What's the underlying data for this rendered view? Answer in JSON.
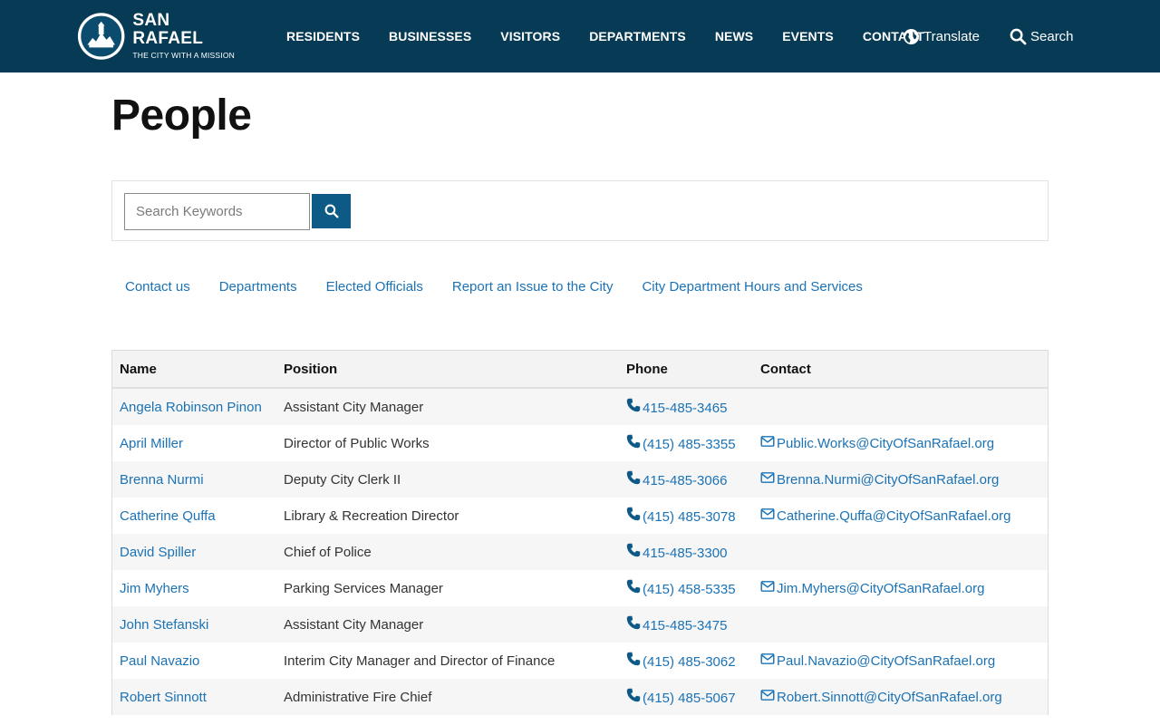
{
  "header": {
    "logo_name": "SAN RAFAEL",
    "logo_tagline": "THE CITY WITH A MISSION",
    "nav": [
      "RESIDENTS",
      "BUSINESSES",
      "VISITORS",
      "DEPARTMENTS",
      "NEWS",
      "EVENTS",
      "CONTACT"
    ],
    "translate_label": "Translate",
    "search_label": "Search",
    "colors": {
      "bar": "#073b55",
      "text": "#ffffff"
    }
  },
  "page": {
    "title": "People"
  },
  "search": {
    "placeholder": "Search Keywords",
    "value": "",
    "button_icon": "search-icon"
  },
  "quick_links": [
    "Contact us",
    "Departments",
    "Elected Officials",
    "Report an Issue to the City",
    "City Department Hours and Services"
  ],
  "table": {
    "columns": [
      "Name",
      "Position",
      "Phone",
      "Contact"
    ],
    "rows": [
      {
        "name": "Angela Robinson Pinon",
        "position": "Assistant City Manager",
        "phone": "415-485-3465",
        "email": ""
      },
      {
        "name": "April Miller",
        "position": "Director of Public Works",
        "phone": "(415) 485-3355",
        "email": "Public.Works@CityOfSanRafael.org"
      },
      {
        "name": "Brenna Nurmi",
        "position": "Deputy City Clerk II",
        "phone": "415-485-3066",
        "email": "Brenna.Nurmi@CityOfSanRafael.org"
      },
      {
        "name": "Catherine Quffa",
        "position": "Library & Recreation Director",
        "phone": "(415) 485-3078",
        "email": "Catherine.Quffa@CityOfSanRafael.org"
      },
      {
        "name": "David Spiller",
        "position": "Chief of Police",
        "phone": "415-485-3300",
        "email": ""
      },
      {
        "name": "Jim Myhers",
        "position": "Parking Services Manager",
        "phone": "(415) 458-5335",
        "email": "Jim.Myhers@CityOfSanRafael.org"
      },
      {
        "name": "John Stefanski",
        "position": "Assistant City Manager",
        "phone": "415-485-3475",
        "email": ""
      },
      {
        "name": "Paul Navazio",
        "position": "Interim City Manager and Director of Finance",
        "phone": "(415) 485-3062",
        "email": "Paul.Navazio@CityOfSanRafael.org"
      },
      {
        "name": "Robert Sinnott",
        "position": "Administrative Fire Chief",
        "phone": "(415) 485-5067",
        "email": "Robert.Sinnott@CityOfSanRafael.org"
      }
    ]
  },
  "colors": {
    "link": "#1b72b5",
    "button": "#0d5a86"
  }
}
